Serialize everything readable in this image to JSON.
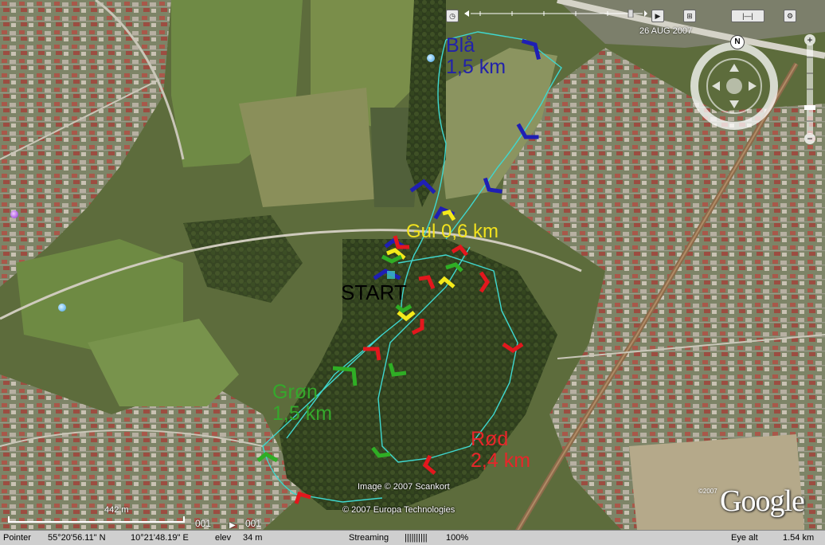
{
  "route_labels": {
    "blue": "Blå\n1,5 km",
    "yellow": "Gul 0,6 km",
    "start": "START",
    "green": "Grøn\n1,5 km",
    "red": "Rød\n2,4 km"
  },
  "route_colors": {
    "blue": "#1f1fb4",
    "yellow": "#f4ea1a",
    "green": "#2fae25",
    "red": "#e3171d",
    "track": "#3fd8d0"
  },
  "credits": {
    "image": "Image © 2007 Scankort",
    "copyright": "© 2007 Europa Technologies",
    "google_year": "©2007",
    "google": "Google"
  },
  "timeline": {
    "date": "26 AUG 2007"
  },
  "scale": {
    "label": "442 m"
  },
  "overlay_counters": {
    "a": "001",
    "b": "001"
  },
  "navigation": {
    "north_label": "N"
  },
  "statusbar": {
    "pointer_label": "Pointer",
    "latitude": "55°20'56.11\" N",
    "longitude": "10°21'48.19\" E",
    "elev_label": "elev",
    "elev_value": "34 m",
    "streaming_label": "Streaming",
    "streaming_bar": "||||||||||",
    "streaming_pct": "100%",
    "eye_alt_label": "Eye alt",
    "eye_alt_value": "1.54 km"
  },
  "icons": [
    "clock-icon",
    "timeline-slider-icon",
    "play-icon",
    "north-arrow-icon",
    "compass-ring-icon",
    "zoom-plus-icon",
    "zoom-minus-icon",
    "placemark-icon"
  ]
}
